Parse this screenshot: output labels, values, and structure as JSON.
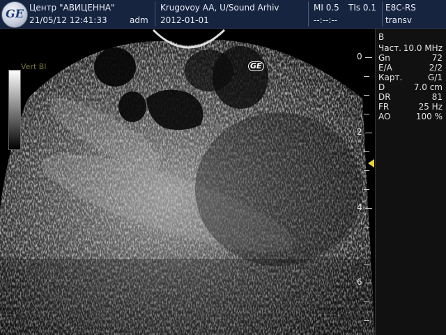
{
  "header": {
    "logo_text": "GE",
    "institution": "Центр \"АВИЦЕННА\"",
    "datetime": "21/05/12 12:41:33",
    "user": "adm",
    "patient": "Krugovoy AA, U/Sound Arhiv",
    "exam_date": "2012-01-01",
    "mi": "MI 0.5",
    "tis": "TIs 0.1",
    "timer": "--:--:--",
    "probe": "E8C-RS",
    "preset": "transv"
  },
  "image": {
    "ge_mark": "GE",
    "faint_label": "Vert Bl"
  },
  "depth_scale": {
    "labels": [
      "0",
      "2",
      "4",
      "6"
    ],
    "unit": "cm"
  },
  "params": {
    "mode": "B",
    "rows": [
      {
        "key": "Част.",
        "value": "10.0 MHz"
      },
      {
        "key": "Gn",
        "value": "72"
      },
      {
        "key": "E/A",
        "value": "2/2"
      },
      {
        "key": "Карт.",
        "value": "G/1"
      },
      {
        "key": "D",
        "value": "7.0 cm"
      },
      {
        "key": "DR",
        "value": "81"
      },
      {
        "key": "FR",
        "value": "25 Hz"
      },
      {
        "key": "AO",
        "value": "100 %"
      }
    ]
  },
  "colors": {
    "header_bg": "#16243f",
    "focus_marker": "#e6d23a"
  }
}
